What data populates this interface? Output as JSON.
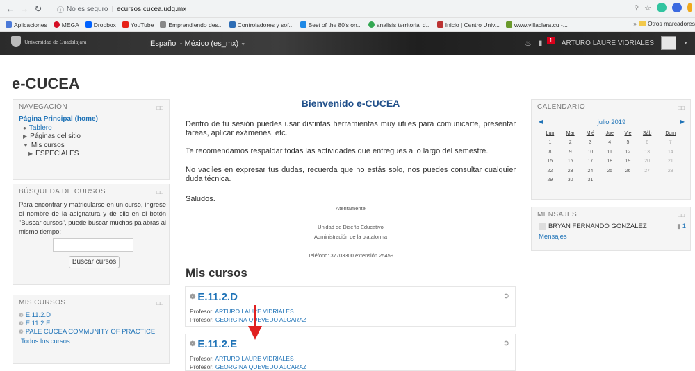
{
  "browser": {
    "security": "No es seguro",
    "url": "ecursos.cucea.udg.mx",
    "bookmarks": [
      "Aplicaciones",
      "MEGA",
      "Dropbox",
      "YouTube",
      "Emprendiendo des...",
      "Controladores y sof...",
      "Best of the 80's on...",
      "analisis territorial d...",
      "Inicio | Centro Univ...",
      "www.villaclara.cu -..."
    ],
    "other_bookmarks": "Otros marcadores"
  },
  "header": {
    "logo_text": "Universidad de Guadalajara",
    "language": "Español - México (es_mx)",
    "user_name": "ARTURO LAURE VIDRIALES",
    "notification_count": "1"
  },
  "site_title": "e-CUCEA",
  "navigation": {
    "title": "NAVEGACIÓN",
    "home": "Página Principal (home)",
    "dashboard": "Tablero",
    "site_pages": "Páginas del sitio",
    "my_courses": "Mis cursos",
    "special": "ESPECIALES"
  },
  "course_search": {
    "title": "BÚSQUEDA DE CURSOS",
    "help": "Para encontrar y matricularse en un curso, ingrese el nombre de la asignatura y de clic en el botón \"Buscar cursos\", puede buscar muchas palabras al mismo tiempo:",
    "input_value": "",
    "button": "Buscar cursos"
  },
  "my_courses_block": {
    "title": "MIS CURSOS",
    "items": [
      "E.11.2.D",
      "E.11.2.E",
      "PALE CUCEA COMMUNITY OF PRACTICE"
    ],
    "all": "Todos los cursos ..."
  },
  "welcome": {
    "title": "Bienvenido e-CUCEA",
    "p1": "Dentro de tu sesión puedes usar distintas herramientas muy útiles para comunicarte, presentar tareas, aplicar exámenes, etc.",
    "p2": "Te recomendamos respaldar todas las actividades que entregues a lo largo del semestre.",
    "p3": "No vaciles en expresar tus dudas, recuerda que no estás solo, nos puedes consultar cualquier duda técnica.",
    "p4": "Saludos.",
    "sign1": "Atentamente",
    "sign2": "Unidad de Diseño Educativo",
    "sign3": "Administración de la plataforma",
    "sign4": "Teléfono: 37703300 extensión 25459"
  },
  "courses_heading": "Mis cursos",
  "courses": [
    {
      "name": "E.11.2.D",
      "prof_label": "Profesor:",
      "prof1": "ARTURO LAURE VIDRIALES",
      "prof2": "GEORGINA QUEVEDO ALCARAZ"
    },
    {
      "name": "E.11.2.E",
      "prof_label": "Profesor:",
      "prof1": "ARTURO LAURE VIDRIALES",
      "prof2": "GEORGINA QUEVEDO ALCARAZ"
    }
  ],
  "calendar": {
    "title": "CALENDARIO",
    "month": "julio 2019",
    "days": [
      "Lun",
      "Mar",
      "Mié",
      "Jue",
      "Vie",
      "Sáb",
      "Dom"
    ],
    "weeks": [
      [
        "1",
        "2",
        "3",
        "4",
        "5",
        "6",
        "7"
      ],
      [
        "8",
        "9",
        "10",
        "11",
        "12",
        "13",
        "14"
      ],
      [
        "15",
        "16",
        "17",
        "18",
        "19",
        "20",
        "21"
      ],
      [
        "22",
        "23",
        "24",
        "25",
        "26",
        "27",
        "28"
      ],
      [
        "29",
        "30",
        "31",
        "",
        "",
        "",
        ""
      ]
    ]
  },
  "messages": {
    "title": "MENSAJES",
    "sender": "BRYAN FERNANDO GONZALEZ",
    "count": "1",
    "link": "Mensajes"
  },
  "colors": {
    "link": "#1f73b7",
    "annotation_arrow": "#e02020"
  }
}
